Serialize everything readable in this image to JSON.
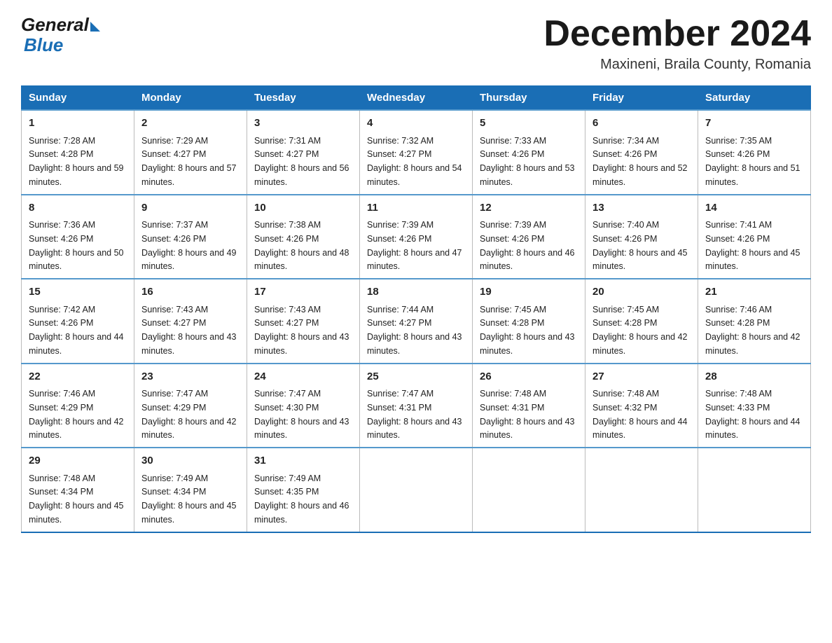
{
  "logo": {
    "general": "General",
    "blue": "Blue"
  },
  "title": "December 2024",
  "location": "Maxineni, Braila County, Romania",
  "days_of_week": [
    "Sunday",
    "Monday",
    "Tuesday",
    "Wednesday",
    "Thursday",
    "Friday",
    "Saturday"
  ],
  "weeks": [
    [
      {
        "day": "1",
        "sunrise": "7:28 AM",
        "sunset": "4:28 PM",
        "daylight": "8 hours and 59 minutes."
      },
      {
        "day": "2",
        "sunrise": "7:29 AM",
        "sunset": "4:27 PM",
        "daylight": "8 hours and 57 minutes."
      },
      {
        "day": "3",
        "sunrise": "7:31 AM",
        "sunset": "4:27 PM",
        "daylight": "8 hours and 56 minutes."
      },
      {
        "day": "4",
        "sunrise": "7:32 AM",
        "sunset": "4:27 PM",
        "daylight": "8 hours and 54 minutes."
      },
      {
        "day": "5",
        "sunrise": "7:33 AM",
        "sunset": "4:26 PM",
        "daylight": "8 hours and 53 minutes."
      },
      {
        "day": "6",
        "sunrise": "7:34 AM",
        "sunset": "4:26 PM",
        "daylight": "8 hours and 52 minutes."
      },
      {
        "day": "7",
        "sunrise": "7:35 AM",
        "sunset": "4:26 PM",
        "daylight": "8 hours and 51 minutes."
      }
    ],
    [
      {
        "day": "8",
        "sunrise": "7:36 AM",
        "sunset": "4:26 PM",
        "daylight": "8 hours and 50 minutes."
      },
      {
        "day": "9",
        "sunrise": "7:37 AM",
        "sunset": "4:26 PM",
        "daylight": "8 hours and 49 minutes."
      },
      {
        "day": "10",
        "sunrise": "7:38 AM",
        "sunset": "4:26 PM",
        "daylight": "8 hours and 48 minutes."
      },
      {
        "day": "11",
        "sunrise": "7:39 AM",
        "sunset": "4:26 PM",
        "daylight": "8 hours and 47 minutes."
      },
      {
        "day": "12",
        "sunrise": "7:39 AM",
        "sunset": "4:26 PM",
        "daylight": "8 hours and 46 minutes."
      },
      {
        "day": "13",
        "sunrise": "7:40 AM",
        "sunset": "4:26 PM",
        "daylight": "8 hours and 45 minutes."
      },
      {
        "day": "14",
        "sunrise": "7:41 AM",
        "sunset": "4:26 PM",
        "daylight": "8 hours and 45 minutes."
      }
    ],
    [
      {
        "day": "15",
        "sunrise": "7:42 AM",
        "sunset": "4:26 PM",
        "daylight": "8 hours and 44 minutes."
      },
      {
        "day": "16",
        "sunrise": "7:43 AM",
        "sunset": "4:27 PM",
        "daylight": "8 hours and 43 minutes."
      },
      {
        "day": "17",
        "sunrise": "7:43 AM",
        "sunset": "4:27 PM",
        "daylight": "8 hours and 43 minutes."
      },
      {
        "day": "18",
        "sunrise": "7:44 AM",
        "sunset": "4:27 PM",
        "daylight": "8 hours and 43 minutes."
      },
      {
        "day": "19",
        "sunrise": "7:45 AM",
        "sunset": "4:28 PM",
        "daylight": "8 hours and 43 minutes."
      },
      {
        "day": "20",
        "sunrise": "7:45 AM",
        "sunset": "4:28 PM",
        "daylight": "8 hours and 42 minutes."
      },
      {
        "day": "21",
        "sunrise": "7:46 AM",
        "sunset": "4:28 PM",
        "daylight": "8 hours and 42 minutes."
      }
    ],
    [
      {
        "day": "22",
        "sunrise": "7:46 AM",
        "sunset": "4:29 PM",
        "daylight": "8 hours and 42 minutes."
      },
      {
        "day": "23",
        "sunrise": "7:47 AM",
        "sunset": "4:29 PM",
        "daylight": "8 hours and 42 minutes."
      },
      {
        "day": "24",
        "sunrise": "7:47 AM",
        "sunset": "4:30 PM",
        "daylight": "8 hours and 43 minutes."
      },
      {
        "day": "25",
        "sunrise": "7:47 AM",
        "sunset": "4:31 PM",
        "daylight": "8 hours and 43 minutes."
      },
      {
        "day": "26",
        "sunrise": "7:48 AM",
        "sunset": "4:31 PM",
        "daylight": "8 hours and 43 minutes."
      },
      {
        "day": "27",
        "sunrise": "7:48 AM",
        "sunset": "4:32 PM",
        "daylight": "8 hours and 44 minutes."
      },
      {
        "day": "28",
        "sunrise": "7:48 AM",
        "sunset": "4:33 PM",
        "daylight": "8 hours and 44 minutes."
      }
    ],
    [
      {
        "day": "29",
        "sunrise": "7:48 AM",
        "sunset": "4:34 PM",
        "daylight": "8 hours and 45 minutes."
      },
      {
        "day": "30",
        "sunrise": "7:49 AM",
        "sunset": "4:34 PM",
        "daylight": "8 hours and 45 minutes."
      },
      {
        "day": "31",
        "sunrise": "7:49 AM",
        "sunset": "4:35 PM",
        "daylight": "8 hours and 46 minutes."
      },
      null,
      null,
      null,
      null
    ]
  ],
  "labels": {
    "sunrise": "Sunrise:",
    "sunset": "Sunset:",
    "daylight": "Daylight:"
  }
}
